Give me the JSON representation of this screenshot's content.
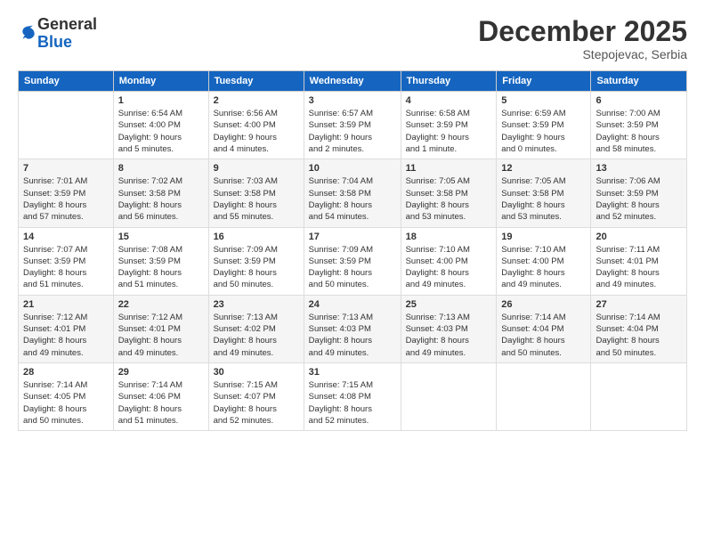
{
  "logo": {
    "general": "General",
    "blue": "Blue"
  },
  "header": {
    "month": "December 2025",
    "location": "Stepojevac, Serbia"
  },
  "weekdays": [
    "Sunday",
    "Monday",
    "Tuesday",
    "Wednesday",
    "Thursday",
    "Friday",
    "Saturday"
  ],
  "weeks": [
    [
      {
        "day": "",
        "info": ""
      },
      {
        "day": "1",
        "info": "Sunrise: 6:54 AM\nSunset: 4:00 PM\nDaylight: 9 hours\nand 5 minutes."
      },
      {
        "day": "2",
        "info": "Sunrise: 6:56 AM\nSunset: 4:00 PM\nDaylight: 9 hours\nand 4 minutes."
      },
      {
        "day": "3",
        "info": "Sunrise: 6:57 AM\nSunset: 3:59 PM\nDaylight: 9 hours\nand 2 minutes."
      },
      {
        "day": "4",
        "info": "Sunrise: 6:58 AM\nSunset: 3:59 PM\nDaylight: 9 hours\nand 1 minute."
      },
      {
        "day": "5",
        "info": "Sunrise: 6:59 AM\nSunset: 3:59 PM\nDaylight: 9 hours\nand 0 minutes."
      },
      {
        "day": "6",
        "info": "Sunrise: 7:00 AM\nSunset: 3:59 PM\nDaylight: 8 hours\nand 58 minutes."
      }
    ],
    [
      {
        "day": "7",
        "info": "Sunrise: 7:01 AM\nSunset: 3:59 PM\nDaylight: 8 hours\nand 57 minutes."
      },
      {
        "day": "8",
        "info": "Sunrise: 7:02 AM\nSunset: 3:58 PM\nDaylight: 8 hours\nand 56 minutes."
      },
      {
        "day": "9",
        "info": "Sunrise: 7:03 AM\nSunset: 3:58 PM\nDaylight: 8 hours\nand 55 minutes."
      },
      {
        "day": "10",
        "info": "Sunrise: 7:04 AM\nSunset: 3:58 PM\nDaylight: 8 hours\nand 54 minutes."
      },
      {
        "day": "11",
        "info": "Sunrise: 7:05 AM\nSunset: 3:58 PM\nDaylight: 8 hours\nand 53 minutes."
      },
      {
        "day": "12",
        "info": "Sunrise: 7:05 AM\nSunset: 3:58 PM\nDaylight: 8 hours\nand 53 minutes."
      },
      {
        "day": "13",
        "info": "Sunrise: 7:06 AM\nSunset: 3:59 PM\nDaylight: 8 hours\nand 52 minutes."
      }
    ],
    [
      {
        "day": "14",
        "info": "Sunrise: 7:07 AM\nSunset: 3:59 PM\nDaylight: 8 hours\nand 51 minutes."
      },
      {
        "day": "15",
        "info": "Sunrise: 7:08 AM\nSunset: 3:59 PM\nDaylight: 8 hours\nand 51 minutes."
      },
      {
        "day": "16",
        "info": "Sunrise: 7:09 AM\nSunset: 3:59 PM\nDaylight: 8 hours\nand 50 minutes."
      },
      {
        "day": "17",
        "info": "Sunrise: 7:09 AM\nSunset: 3:59 PM\nDaylight: 8 hours\nand 50 minutes."
      },
      {
        "day": "18",
        "info": "Sunrise: 7:10 AM\nSunset: 4:00 PM\nDaylight: 8 hours\nand 49 minutes."
      },
      {
        "day": "19",
        "info": "Sunrise: 7:10 AM\nSunset: 4:00 PM\nDaylight: 8 hours\nand 49 minutes."
      },
      {
        "day": "20",
        "info": "Sunrise: 7:11 AM\nSunset: 4:01 PM\nDaylight: 8 hours\nand 49 minutes."
      }
    ],
    [
      {
        "day": "21",
        "info": "Sunrise: 7:12 AM\nSunset: 4:01 PM\nDaylight: 8 hours\nand 49 minutes."
      },
      {
        "day": "22",
        "info": "Sunrise: 7:12 AM\nSunset: 4:01 PM\nDaylight: 8 hours\nand 49 minutes."
      },
      {
        "day": "23",
        "info": "Sunrise: 7:13 AM\nSunset: 4:02 PM\nDaylight: 8 hours\nand 49 minutes."
      },
      {
        "day": "24",
        "info": "Sunrise: 7:13 AM\nSunset: 4:03 PM\nDaylight: 8 hours\nand 49 minutes."
      },
      {
        "day": "25",
        "info": "Sunrise: 7:13 AM\nSunset: 4:03 PM\nDaylight: 8 hours\nand 49 minutes."
      },
      {
        "day": "26",
        "info": "Sunrise: 7:14 AM\nSunset: 4:04 PM\nDaylight: 8 hours\nand 50 minutes."
      },
      {
        "day": "27",
        "info": "Sunrise: 7:14 AM\nSunset: 4:04 PM\nDaylight: 8 hours\nand 50 minutes."
      }
    ],
    [
      {
        "day": "28",
        "info": "Sunrise: 7:14 AM\nSunset: 4:05 PM\nDaylight: 8 hours\nand 50 minutes."
      },
      {
        "day": "29",
        "info": "Sunrise: 7:14 AM\nSunset: 4:06 PM\nDaylight: 8 hours\nand 51 minutes."
      },
      {
        "day": "30",
        "info": "Sunrise: 7:15 AM\nSunset: 4:07 PM\nDaylight: 8 hours\nand 52 minutes."
      },
      {
        "day": "31",
        "info": "Sunrise: 7:15 AM\nSunset: 4:08 PM\nDaylight: 8 hours\nand 52 minutes."
      },
      {
        "day": "",
        "info": ""
      },
      {
        "day": "",
        "info": ""
      },
      {
        "day": "",
        "info": ""
      }
    ]
  ]
}
